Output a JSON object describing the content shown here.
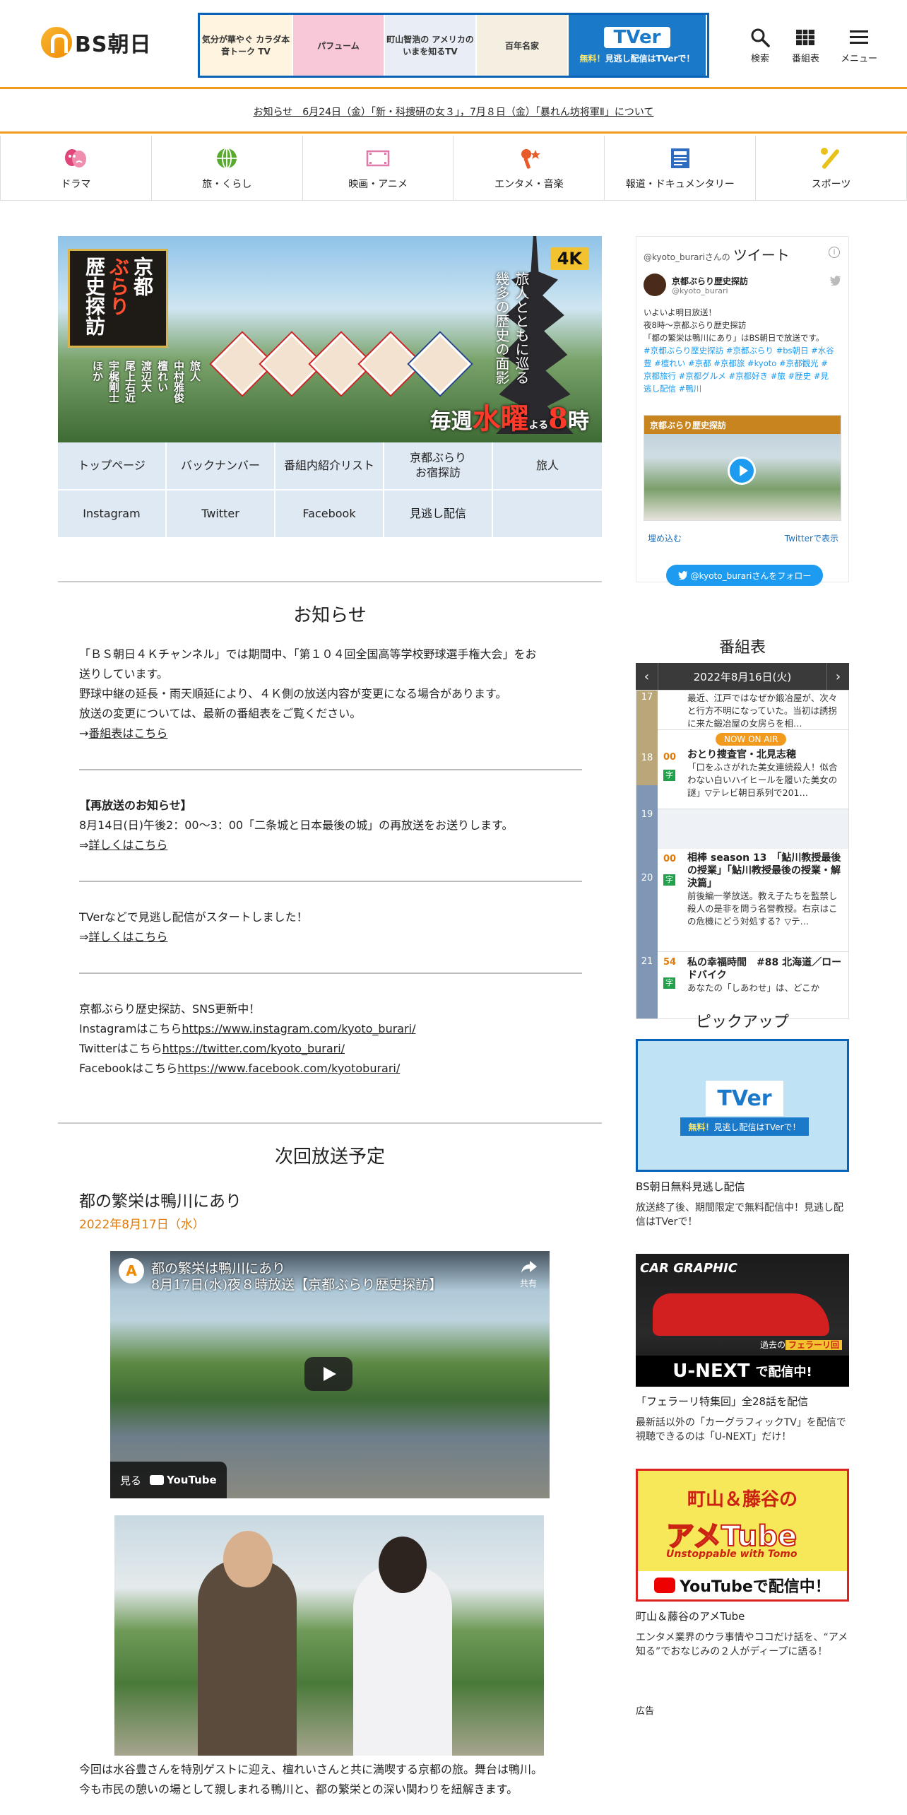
{
  "header": {
    "logo_text": "BS朝日",
    "banner": {
      "cell1": "気分が華やぐ カラダ本音トーク TV",
      "cell2": "パフューム",
      "cell3": "町山智浩の アメリカの いまを知るTV",
      "cell4": "百年名家",
      "tver_logo": "TVer",
      "free_prefix": "無料！",
      "free_text": "見逃し配信はTVerで！"
    },
    "buttons": [
      {
        "label": "検索",
        "icon": "search-icon"
      },
      {
        "label": "番組表",
        "icon": "grid-icon"
      },
      {
        "label": "メニュー",
        "icon": "menu-icon"
      }
    ]
  },
  "notice_bar": "お知らせ　6月24日（金）「新・科捜研の女３」，7月８日（金）「暴れん坊将軍Ⅱ」について",
  "genres": [
    {
      "label": "ドラマ",
      "icon": "drama-masks-icon",
      "color": "#e0457b"
    },
    {
      "label": "旅・くらし",
      "icon": "globe-icon",
      "color": "#5aaa2f"
    },
    {
      "label": "映画・アニメ",
      "icon": "film-icon",
      "color": "#e07aa8"
    },
    {
      "label": "エンタメ・音楽",
      "icon": "microphone-star-icon",
      "color": "#e85a2a"
    },
    {
      "label": "報道・ドキュメンタリー",
      "icon": "newspaper-icon",
      "color": "#2d6cc0"
    },
    {
      "label": "スポーツ",
      "icon": "bat-ball-icon",
      "color": "#e8c21a"
    }
  ],
  "hero": {
    "title_col1": "京都",
    "title_col2": "ぶらり",
    "title_col3": "歴史探訪",
    "badge": "4K",
    "subtitle_1": "旅人とともに巡る",
    "subtitle_2": "幾多の歴史の面影",
    "cast_heading": "旅人",
    "cast": [
      "中村雅俊",
      "檀れい",
      "渡辺大",
      "尾上右近",
      "宇梶剛士",
      "ほか"
    ],
    "schedule_prefix": "毎週",
    "schedule_day": "水曜",
    "schedule_mid": "よる",
    "schedule_hour": "8",
    "schedule_suffix": "時"
  },
  "subnav": [
    "トップページ",
    "バックナンバー",
    "番組内紹介リスト",
    "京都ぶらり\nお宿探訪",
    "旅人",
    "Instagram",
    "Twitter",
    "Facebook",
    "見逃し配信",
    ""
  ],
  "news": {
    "title": "お知らせ",
    "p1_line1": "「ＢＳ朝日４Ｋチャンネル」では期間中、「第１０４回全国高等学校野球選手権大会」をお",
    "p1_line2": "送りしています。",
    "p1_line3": "野球中継の延長・雨天順延により、４Ｋ側の放送内容が変更になる場合があります。",
    "p1_line4": "放送の変更については、最新の番組表をご覧ください。",
    "p1_arrow": "→",
    "p1_link": "番組表はこちら",
    "p2_heading": "【再放送のお知らせ】",
    "p2_line1": "8月14日(日)午後2：00〜3：00「二条城と日本最後の城」の再放送をお送りします。",
    "p2_arrow": "⇒",
    "p2_link": "詳しくはこちら",
    "p3_line1": "TVerなどで見逃し配信がスタートしました！",
    "p3_arrow": "⇒",
    "p3_link": "詳しくはこちら",
    "p4_line1": "京都ぶらり歴史探訪、SNS更新中！",
    "p4_ig_label": "Instagramはこちら",
    "p4_ig_url": "https://www.instagram.com/kyoto_burari/",
    "p4_tw_label": "Twitterはこちら",
    "p4_tw_url": "https://twitter.com/kyoto_burari/",
    "p4_fb_label": "Facebookはこちら",
    "p4_fb_url": "https://www.facebook.com/kyotoburari/"
  },
  "next": {
    "title": "次回放送予定",
    "ep_title": "都の繁栄は鴨川にあり",
    "ep_date": "2022年8月17日（水）",
    "video_title_1": "都の繁栄は鴨川にあり",
    "video_title_2": "8月17日(水)夜８時放送【京都ぶらり歴史探訪】",
    "video_share": "共有",
    "video_watch": "見る",
    "video_yt": "YouTube",
    "caption_1": "今回は水谷豊さんを特別ゲストに迎え、檀れいさんと共に満喫する京都の旅。舞台は鴨川。",
    "caption_2": "今も市民の憩いの場として親しまれる鴨川と、都の繁栄との深い関わりを紐解きます。"
  },
  "twitter": {
    "header_handle": "@kyoto_burari",
    "header_suffix": "さんの",
    "header_title": "ツイート",
    "name": "京都ぶらり歴史探訪",
    "handle": "@kyoto_burari",
    "line1": "いよいよ明日放送！",
    "line2": "夜8時～京都ぶらり歴史探訪",
    "line3": "「都の繁栄は鴨川にあり」はBS朝日で放送です。",
    "tags": "#京都ぶらり歴史探訪 #京都ぶらり #bs朝日 #水谷豊 #檀れい #京都 #京都旅 #kyoto #京都観光 #京都旅行 #京都グルメ #京都好き #旅 #歴史 #見逃し配信 #鴨川",
    "media_band": "京都ぶらり歴史探訪",
    "embed": "埋め込む",
    "view": "Twitterで表示",
    "follow": "@kyoto_burariさんをフォロー"
  },
  "schedule": {
    "title": "番組表",
    "date": "2022年8月16日(火)",
    "prev": "‹",
    "next": "›",
    "rows": [
      {
        "hour": "17",
        "minute": "",
        "title": "",
        "desc": "最近、江戸ではなぜか鍛冶屋が、次々と行方不明になっていた。当初は誘拐に来た鍛冶屋の女房らを相…"
      },
      {
        "hour": "18",
        "minute": "00",
        "badge": "字",
        "title": "おとり捜査官・北見志穂",
        "desc": "「口をふさがれた美女連続殺人！似合わない白いハイヒールを履いた美女の謎」▽テレビ朝日系列で201…",
        "now": "NOW ON AIR"
      },
      {
        "hour": "19",
        "minute": "",
        "title": "",
        "desc": ""
      },
      {
        "hour": "20",
        "minute": "00",
        "badge": "字",
        "title": "相棒 season 13　「鮎川教授最後の授業」「鮎川教授最後の授業・解決篇」",
        "desc": "前後編一挙放送。教え子たちを監禁し殺人の是非を問う名誉教授。右京はこの危機にどう対処する？▽テ…"
      },
      {
        "hour": "21",
        "minute": "54",
        "badge": "字",
        "title": "私の幸福時間　#88 北海道／ロードバイク",
        "desc": "あなたの「しあわせ」は、どこか"
      }
    ]
  },
  "pickup": {
    "title": "ピックアップ",
    "items": [
      {
        "name": "BS朝日無料見逃し配信",
        "desc": "放送終了後、期間限定で無料配信中！見逃し配信はTVerで！",
        "img_logo": "TVer",
        "img_free": "無料！",
        "img_text": "見逃し配信はTVerで！"
      },
      {
        "name": "「フェラーリ特集回」全28話を配信",
        "desc": "最新話以外の「カーグラフィックTV」を配信で視聴できるのは「U-NEXT」だけ！",
        "img_logo": "CAR GRAPHIC",
        "img_tag_pre": "過去の",
        "img_tag": "フェラーリ回",
        "img_un": "U-NEXT",
        "img_un_suffix": "で配信中!"
      },
      {
        "name": "町山＆藤谷のアメTube",
        "desc": "エンタメ業界のウラ事情やココだけ話を、“アメ知る”でおなじみの２人がディープに語る！",
        "img_t1": "町山＆藤谷の",
        "img_t2": "アメTube",
        "img_t3": "Unstoppable with Tomo",
        "img_yt": "YouTubeで配信中！"
      }
    ]
  },
  "ad_label": "広告",
  "colors": {
    "accent": "#f29a1e",
    "link": "#1d6fb8",
    "subnav_bg": "#dfe9f3",
    "twitter": "#1d9bf0"
  }
}
